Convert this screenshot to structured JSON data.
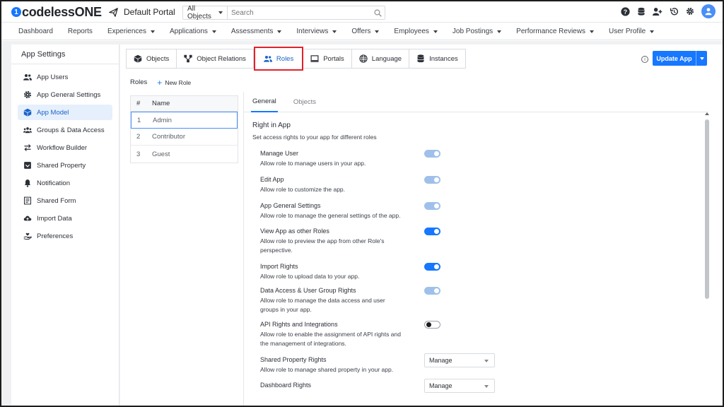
{
  "app": {
    "logo_mark": "1",
    "logo_text": "codelessONE",
    "portal_name": "Default Portal"
  },
  "search": {
    "scope": "All Objects",
    "placeholder": "Search"
  },
  "nav": {
    "items": [
      {
        "label": "Dashboard",
        "dropdown": false
      },
      {
        "label": "Reports",
        "dropdown": false
      },
      {
        "label": "Experiences",
        "dropdown": true
      },
      {
        "label": "Applications",
        "dropdown": true
      },
      {
        "label": "Assessments",
        "dropdown": true
      },
      {
        "label": "Interviews",
        "dropdown": true
      },
      {
        "label": "Offers",
        "dropdown": true
      },
      {
        "label": "Employees",
        "dropdown": true
      },
      {
        "label": "Job Postings",
        "dropdown": true
      },
      {
        "label": "Performance Reviews",
        "dropdown": true
      },
      {
        "label": "User Profile",
        "dropdown": true
      }
    ]
  },
  "sidebar": {
    "title": "App Settings",
    "items": [
      {
        "label": "App Users",
        "icon": "users-icon"
      },
      {
        "label": "App General Settings",
        "icon": "gear-icon"
      },
      {
        "label": "App Model",
        "icon": "cube-icon",
        "active": true
      },
      {
        "label": "Groups & Data Access",
        "icon": "group-icon"
      },
      {
        "label": "Workflow Builder",
        "icon": "swap-arrows-icon"
      },
      {
        "label": "Shared Property",
        "icon": "shared-box-icon"
      },
      {
        "label": "Notification",
        "icon": "bell-icon"
      },
      {
        "label": "Shared Form",
        "icon": "form-icon"
      },
      {
        "label": "Import Data",
        "icon": "cloud-upload-icon"
      },
      {
        "label": "Preferences",
        "icon": "hand-heart-icon"
      }
    ]
  },
  "tabs": [
    {
      "label": "Objects",
      "icon": "cube-icon"
    },
    {
      "label": "Object Relations",
      "icon": "relations-icon"
    },
    {
      "label": "Roles",
      "icon": "users-icon",
      "active": true
    },
    {
      "label": "Portals",
      "icon": "monitor-icon"
    },
    {
      "label": "Language",
      "icon": "globe-icon"
    },
    {
      "label": "Instances",
      "icon": "database-icon"
    }
  ],
  "actions": {
    "update_label": "Update App",
    "info_glyph": "i"
  },
  "roles": {
    "header": "Roles",
    "new_label": "New Role",
    "columns": {
      "num": "#",
      "name": "Name"
    },
    "rows": [
      {
        "num": "1",
        "name": "Admin",
        "selected": true
      },
      {
        "num": "2",
        "name": "Contributor"
      },
      {
        "num": "3",
        "name": "Guest"
      }
    ]
  },
  "details": {
    "tabs": [
      {
        "label": "General",
        "active": true
      },
      {
        "label": "Objects"
      }
    ],
    "section_title": "Right in App",
    "section_subtitle": "Set access rights to your app for different roles",
    "permissions": [
      {
        "title": "Manage User",
        "desc": "Allow role to manage users in your app.",
        "control": "toggle",
        "state": "on-disabled"
      },
      {
        "title": "Edit App",
        "desc": "Allow role to customize the app.",
        "control": "toggle",
        "state": "on-disabled"
      },
      {
        "title": "App General Settings",
        "desc": "Allow role to manage the general settings of the app.",
        "control": "toggle",
        "state": "on-disabled"
      },
      {
        "title": "View App as other Roles",
        "desc": "Allow role to preview the app from other Role's perspective.",
        "control": "toggle",
        "state": "on"
      },
      {
        "title": "Import Rights",
        "desc": "Allow role to upload data to your app.",
        "control": "toggle",
        "state": "on"
      },
      {
        "title": "Data Access & User Group Rights",
        "desc": "Allow role to manage the data access and user groups in your app.",
        "control": "toggle",
        "state": "on-disabled"
      },
      {
        "title": "API Rights and Integrations",
        "desc": "Allow role to enable the assignment of API rights and the management of integrations.",
        "control": "toggle",
        "state": "off"
      },
      {
        "title": "Shared Property Rights",
        "desc": "Allow role to manage shared property in your app.",
        "control": "select",
        "value": "Manage"
      },
      {
        "title": "Dashboard Rights",
        "desc": "",
        "control": "select",
        "value": "Manage"
      }
    ]
  },
  "colors": {
    "accent": "#1677ff",
    "highlight_border": "#e2222a",
    "toggle_disabled": "#9fc0ea"
  }
}
